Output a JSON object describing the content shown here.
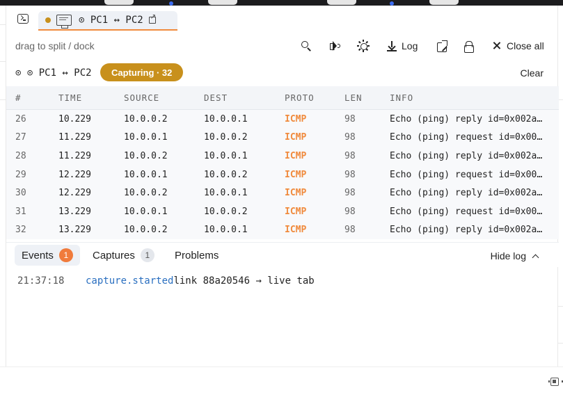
{
  "window": {
    "tab": {
      "title": "⊙ PC1 ↔ PC2",
      "status_color": "#c8901c",
      "accent_color": "#f08a3c"
    }
  },
  "toolbar": {
    "hint": "drag to split / dock",
    "log_label": "Log",
    "close_all_label": "Close all",
    "icons": [
      "search-icon",
      "speaker-icon",
      "sun-icon",
      "download-icon",
      "external-link-icon",
      "unlock-icon",
      "close-icon"
    ]
  },
  "capture": {
    "title": "⊙ ⊙ PC1 ↔ PC2",
    "badge": "Capturing · 32",
    "badge_color": "#c8901c",
    "clear_label": "Clear"
  },
  "packets": {
    "columns": [
      "#",
      "TIME",
      "SOURCE",
      "DEST",
      "PROTO",
      "LEN",
      "INFO"
    ],
    "rows": [
      [
        "26",
        "10.229",
        "10.0.0.2",
        "10.0.0.1",
        "ICMP",
        "98",
        "Echo (ping) reply id=0x002a…"
      ],
      [
        "27",
        "11.229",
        "10.0.0.1",
        "10.0.0.2",
        "ICMP",
        "98",
        "Echo (ping) request id=0x00…"
      ],
      [
        "28",
        "11.229",
        "10.0.0.2",
        "10.0.0.1",
        "ICMP",
        "98",
        "Echo (ping) reply id=0x002a…"
      ],
      [
        "29",
        "12.229",
        "10.0.0.1",
        "10.0.0.2",
        "ICMP",
        "98",
        "Echo (ping) request id=0x00…"
      ],
      [
        "30",
        "12.229",
        "10.0.0.2",
        "10.0.0.1",
        "ICMP",
        "98",
        "Echo (ping) reply id=0x002a…"
      ],
      [
        "31",
        "13.229",
        "10.0.0.1",
        "10.0.0.2",
        "ICMP",
        "98",
        "Echo (ping) request id=0x00…"
      ],
      [
        "32",
        "13.229",
        "10.0.0.2",
        "10.0.0.1",
        "ICMP",
        "98",
        "Echo (ping) reply id=0x002a…"
      ]
    ],
    "proto_color": "#f08a3c"
  },
  "log_panel": {
    "tabs": [
      {
        "label": "Events",
        "count": "1"
      },
      {
        "label": "Captures",
        "count": "1"
      },
      {
        "label": "Problems"
      }
    ],
    "hide_label": "Hide log",
    "entries": [
      {
        "time": "21:37:18",
        "event": "capture.started",
        "message": "link 88a20546 → live tab"
      }
    ]
  }
}
